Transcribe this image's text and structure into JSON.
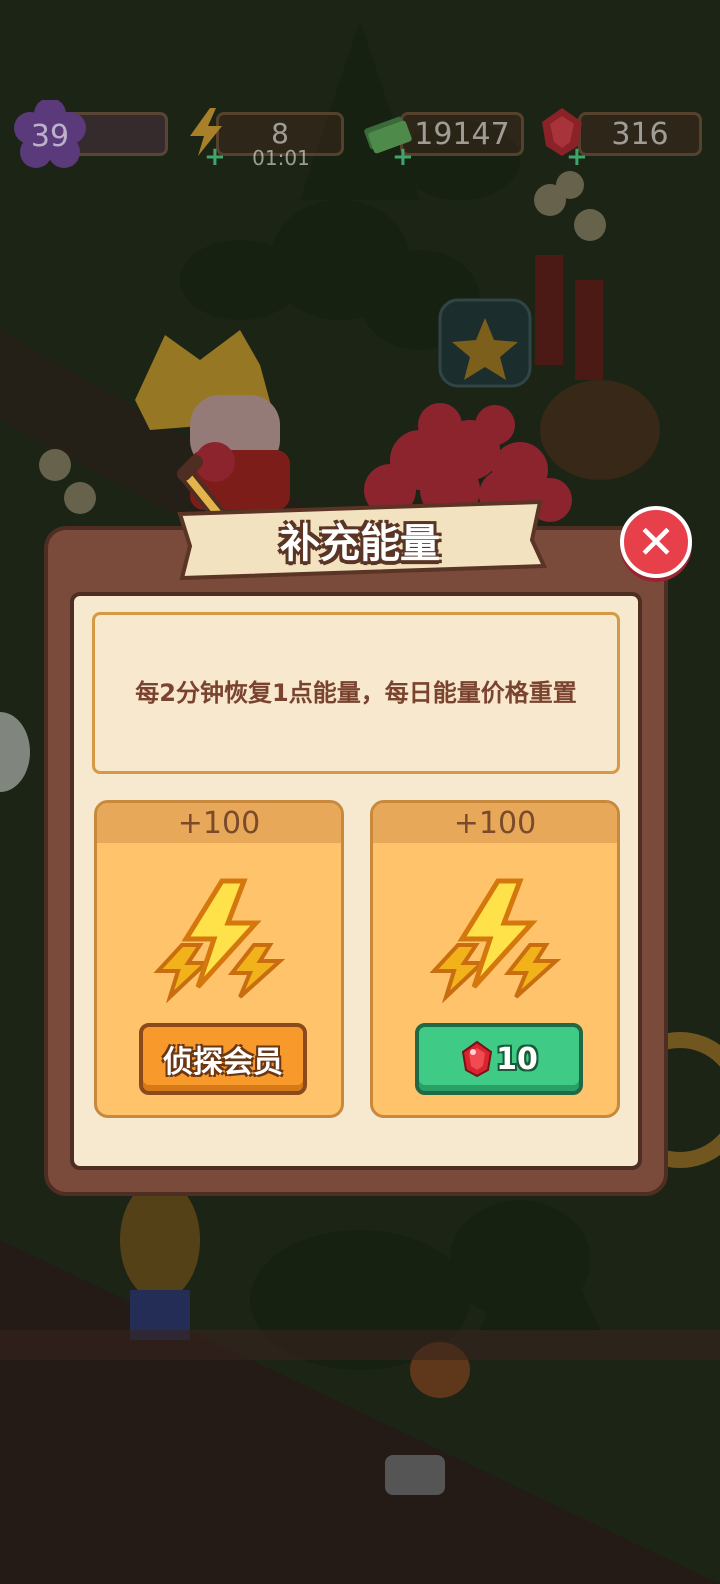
{
  "hud": {
    "level": "39",
    "energy": "8",
    "energy_timer": "01:01",
    "cash": "19147",
    "gems": "316"
  },
  "dialog": {
    "title": "补充能量",
    "description": "每2分钟恢复1点能量，每日能量价格重置",
    "options": [
      {
        "amount": "+100",
        "button_label": "侦探会员",
        "button_style": "orange"
      },
      {
        "amount": "+100",
        "button_label": "10",
        "button_icon": "ruby-gem-icon",
        "button_style": "green"
      }
    ]
  },
  "colors": {
    "dialog_frame": "#7a4a3a",
    "panel_bg": "#f6e9cf",
    "card_bg": "#ffc36b",
    "close_red": "#e8404b",
    "btn_orange": "#f79a2b",
    "btn_green": "#3fcb86"
  }
}
